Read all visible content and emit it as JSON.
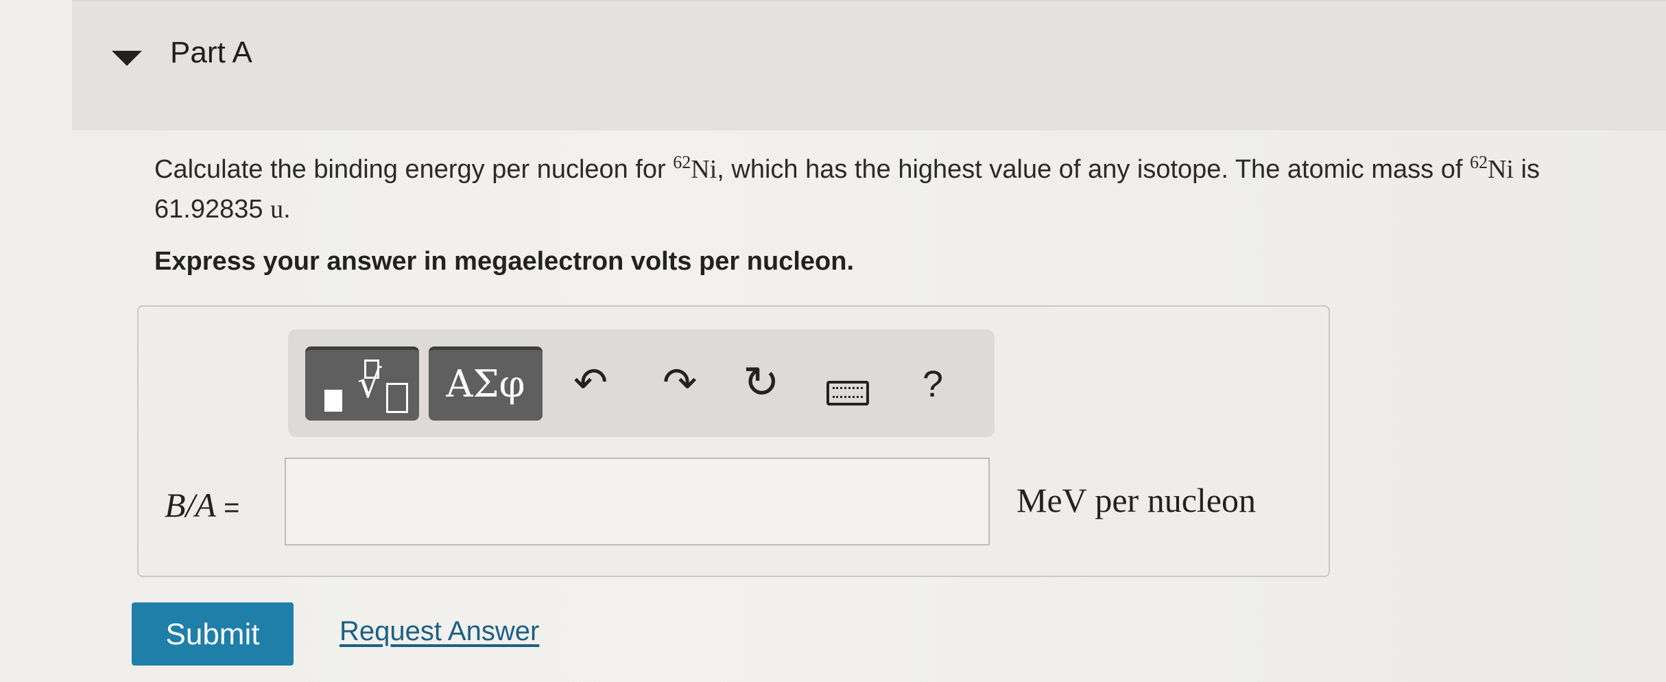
{
  "part": {
    "title": "Part A"
  },
  "question": {
    "text_1": "Calculate the binding energy per nucleon for ",
    "isotope_mass_number": "62",
    "isotope_symbol": "Ni",
    "text_2": ", which has the highest value of any isotope. The atomic mass of ",
    "isotope_mass_number_2": "62",
    "isotope_symbol_2": "Ni",
    "text_3": " is 61.92835 ",
    "unit": "u",
    "text_4": "."
  },
  "instruction": "Express your answer in megaelectron volts per nucleon.",
  "toolbar": {
    "greek_label": "ΑΣφ",
    "undo_glyph": "↶",
    "redo_glyph": "↷",
    "reset_glyph": "↻",
    "help_label": "?"
  },
  "answer": {
    "label": "B/A",
    "equals": " =",
    "value": "",
    "units": "MeV per nucleon"
  },
  "actions": {
    "submit_label": "Submit",
    "request_label": "Request Answer"
  },
  "colors": {
    "submit_bg": "#1f7fa8",
    "link": "#1d5f84",
    "toolbar_button": "#5f5f5f"
  }
}
